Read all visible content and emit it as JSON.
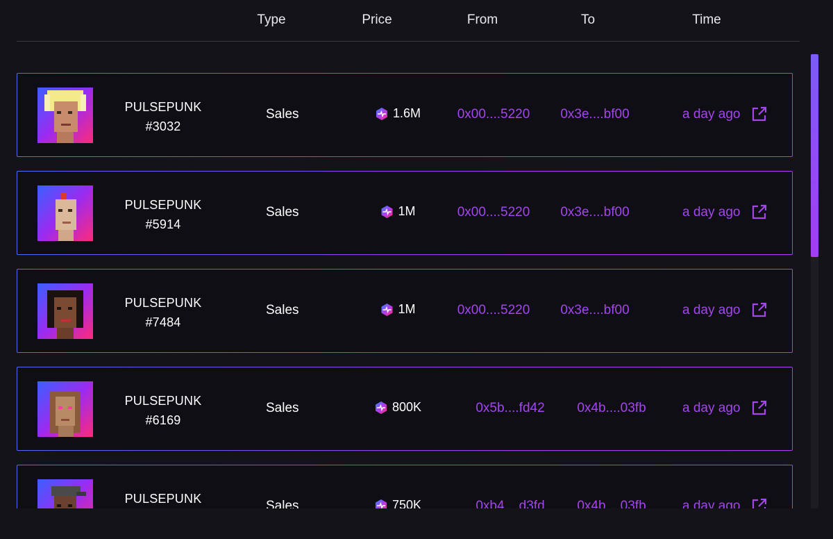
{
  "columns": {
    "type": "Type",
    "price": "Price",
    "from": "From",
    "to": "To",
    "time": "Time"
  },
  "rows": [
    {
      "name_line1": "PULSEPUNK",
      "name_line2": "#3032",
      "type": "Sales",
      "price": "1.6M",
      "from": "0x00....5220",
      "to": "0x3e....bf00",
      "time": "a day ago",
      "avatar": "punk-blonde-hair"
    },
    {
      "name_line1": "PULSEPUNK",
      "name_line2": "#5914",
      "type": "Sales",
      "price": "1M",
      "from": "0x00....5220",
      "to": "0x3e....bf00",
      "time": "a day ago",
      "avatar": "punk-mohawk"
    },
    {
      "name_line1": "PULSEPUNK",
      "name_line2": "#7484",
      "type": "Sales",
      "price": "1M",
      "from": "0x00....5220",
      "to": "0x3e....bf00",
      "time": "a day ago",
      "avatar": "punk-dark-hair"
    },
    {
      "name_line1": "PULSEPUNK",
      "name_line2": "#6169",
      "type": "Sales",
      "price": "800K",
      "from": "0x5b....fd42",
      "to": "0x4b....03fb",
      "time": "a day ago",
      "avatar": "punk-brown-hair"
    },
    {
      "name_line1": "PULSEPUNK",
      "name_line2": "",
      "type": "Sales",
      "price": "750K",
      "from": "0xb4....d3fd",
      "to": "0x4b....03fb",
      "time": "a day ago",
      "avatar": "punk-cap"
    }
  ],
  "colors": {
    "background": "#141318",
    "row_background": "#0f0e14",
    "accent_purple": "#a445f0",
    "border_blue": "#4d6ef0",
    "border_purple": "#b03cf5"
  },
  "icons": {
    "price": "pulse-coin-icon",
    "time_link": "external-link-icon"
  }
}
